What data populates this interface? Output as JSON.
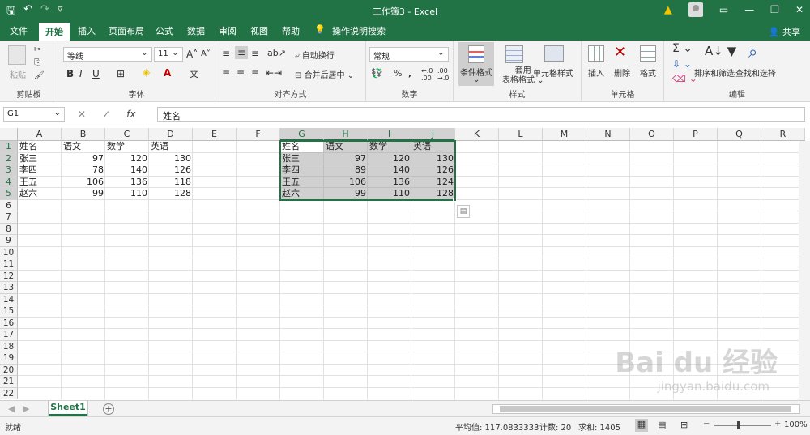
{
  "window": {
    "title": "工作簿3 - Excel"
  },
  "ribbon_tabs": [
    "文件",
    "开始",
    "插入",
    "页面布局",
    "公式",
    "数据",
    "审阅",
    "视图",
    "帮助",
    "操作说明搜索"
  ],
  "share_label": "共享",
  "ribbon": {
    "clipboard": {
      "paste": "粘贴",
      "label": "剪贴板"
    },
    "font": {
      "name": "等线",
      "size": "11",
      "label": "字体"
    },
    "alignment": {
      "wrap": "自动换行",
      "merge": "合并后居中",
      "label": "对齐方式"
    },
    "number": {
      "format": "常规",
      "label": "数字"
    },
    "styles": {
      "conditional": "条件格式",
      "table": "套用",
      "table2": "表格格式",
      "cell_styles": "单元格样式",
      "label": "样式"
    },
    "cells": {
      "insert": "插入",
      "delete": "删除",
      "format": "格式",
      "label": "单元格"
    },
    "editing": {
      "sort": "排序和筛选",
      "find": "查找和选择",
      "label": "编辑"
    }
  },
  "formula_bar": {
    "name_box": "G1",
    "content": "姓名"
  },
  "columns": [
    "A",
    "B",
    "C",
    "D",
    "E",
    "F",
    "G",
    "H",
    "I",
    "J",
    "K",
    "L",
    "M",
    "N",
    "O",
    "P",
    "Q",
    "R"
  ],
  "rows": [
    "1",
    "2",
    "3",
    "4",
    "5",
    "6",
    "7",
    "8",
    "9",
    "10",
    "11",
    "12",
    "13",
    "14",
    "15",
    "16",
    "17",
    "18",
    "19",
    "20",
    "21",
    "22"
  ],
  "table_left": {
    "headers": [
      "姓名",
      "语文",
      "数学",
      "英语"
    ],
    "rows": [
      [
        "张三",
        "97",
        "120",
        "130"
      ],
      [
        "李四",
        "78",
        "140",
        "126"
      ],
      [
        "王五",
        "106",
        "136",
        "118"
      ],
      [
        "赵六",
        "99",
        "110",
        "128"
      ]
    ]
  },
  "table_right": {
    "headers": [
      "姓名",
      "语文",
      "数学",
      "英语"
    ],
    "rows": [
      [
        "张三",
        "97",
        "120",
        "130"
      ],
      [
        "李四",
        "89",
        "140",
        "126"
      ],
      [
        "王五",
        "106",
        "136",
        "124"
      ],
      [
        "赵六",
        "99",
        "110",
        "128"
      ]
    ]
  },
  "sheets": [
    "Sheet1"
  ],
  "status": {
    "mode": "就绪",
    "average": "平均值: 117.0833333",
    "count": "计数: 20",
    "sum": "求和: 1405",
    "zoom": "100%"
  },
  "watermark": {
    "line1": "Bai du 经验",
    "line2": "jingyan.baidu.com"
  },
  "colors": {
    "accent": "#217346"
  }
}
